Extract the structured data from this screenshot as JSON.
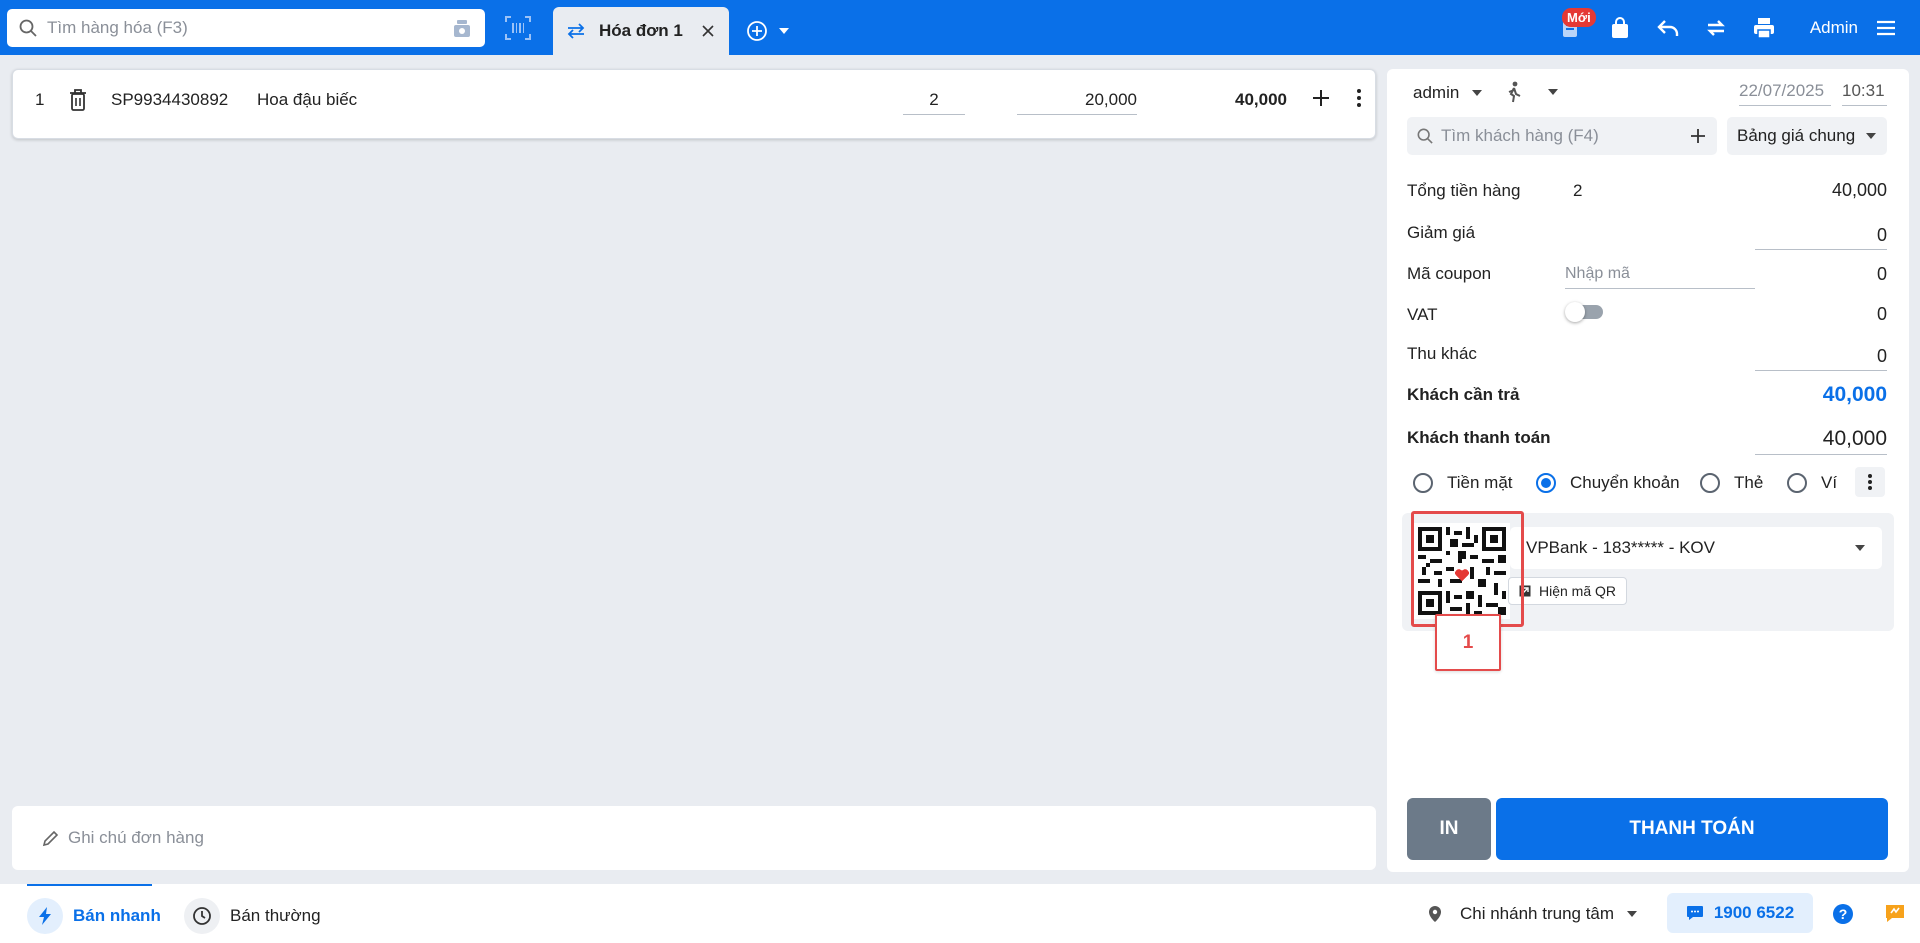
{
  "topbar": {
    "search_placeholder": "Tìm hàng hóa (F3)",
    "tab_label": "Hóa đơn 1",
    "new_badge": "Mới",
    "user": "Admin"
  },
  "cart": {
    "rows": [
      {
        "index": "1",
        "code": "SP9934430892",
        "name": "Hoa đậu biếc",
        "qty": "2",
        "price": "20,000",
        "total": "40,000"
      }
    ]
  },
  "note": {
    "placeholder": "Ghi chú đơn hàng"
  },
  "panel": {
    "seller": "admin",
    "date": "22/07/2025",
    "time": "10:31",
    "customer_placeholder": "Tìm khách hàng (F4)",
    "price_list": "Bảng giá chung",
    "summary": {
      "subtotal_label": "Tổng tiền hàng",
      "subtotal_qty": "2",
      "subtotal_value": "40,000",
      "discount_label": "Giảm giá",
      "discount_value": "0",
      "coupon_label": "Mã coupon",
      "coupon_placeholder": "Nhập mã",
      "coupon_value": "0",
      "vat_label": "VAT",
      "vat_value": "0",
      "other_label": "Thu khác",
      "other_value": "0",
      "due_label": "Khách cần trả",
      "due_value": "40,000",
      "paid_label": "Khách thanh toán",
      "paid_value": "40,000"
    },
    "payment_methods": [
      {
        "label": "Tiền mặt",
        "selected": false
      },
      {
        "label": "Chuyển khoản",
        "selected": true
      },
      {
        "label": "Thẻ",
        "selected": false
      },
      {
        "label": "Ví",
        "selected": false
      }
    ],
    "bank_account": "VPBank - 183***** - KOV",
    "show_qr_label": "Hiện mã QR",
    "callout_number": "1",
    "print_label": "IN",
    "pay_label": "THANH TOÁN"
  },
  "bottombar": {
    "quick_sale": "Bán nhanh",
    "normal_sale": "Bán thường",
    "branch": "Chi nhánh trung tâm",
    "hotline": "1900 6522"
  },
  "colors": {
    "primary": "#0a70e8",
    "danger": "#e53935",
    "annotation": "#e44b4b"
  }
}
